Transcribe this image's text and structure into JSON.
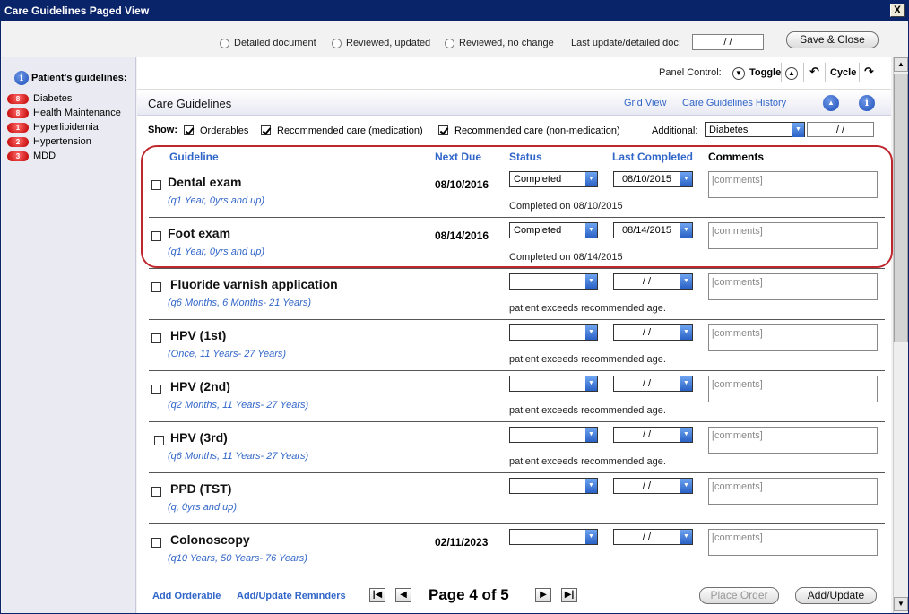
{
  "window": {
    "title": "Care Guidelines Paged View",
    "close": "X"
  },
  "top": {
    "radios": [
      "Detailed document",
      "Reviewed, updated",
      "Reviewed, no change"
    ],
    "last_update_label": "Last update/detailed doc:",
    "last_update_value": "/ /",
    "save_close": "Save & Close"
  },
  "sidebar": {
    "title": "Patient's guidelines:",
    "items": [
      {
        "count": "8",
        "label": "Diabetes"
      },
      {
        "count": "8",
        "label": "Health Maintenance"
      },
      {
        "count": "1",
        "label": "Hyperlipidemia"
      },
      {
        "count": "2",
        "label": "Hypertension"
      },
      {
        "count": "3",
        "label": "MDD"
      }
    ]
  },
  "panel": {
    "label": "Panel Control:",
    "toggle": "Toggle",
    "cycle": "Cycle"
  },
  "cg": {
    "title": "Care Guidelines",
    "grid_view": "Grid View",
    "history": "Care Guidelines History"
  },
  "show": {
    "label": "Show:",
    "orderables": "Orderables",
    "rec_med": "Recommended care (medication)",
    "rec_nonmed": "Recommended care (non-medication)",
    "additional_label": "Additional:",
    "additional_value": "Diabetes",
    "additional_date": "/ /"
  },
  "columns": {
    "guideline": "Guideline",
    "next_due": "Next Due",
    "status": "Status",
    "last_completed": "Last Completed",
    "comments": "Comments"
  },
  "rows": [
    {
      "name": "Dental exam",
      "freq": "(q1 Year, 0yrs and up)",
      "due": "08/10/2016",
      "status": "Completed",
      "last": "08/10/2015",
      "comment": "[comments]",
      "note": "Completed on 08/10/2015"
    },
    {
      "name": "Foot exam",
      "freq": "(q1 Year, 0yrs and up)",
      "due": "08/14/2016",
      "status": "Completed",
      "last": "08/14/2015",
      "comment": "[comments]",
      "note": "Completed on 08/14/2015"
    },
    {
      "name": "Fluoride varnish application",
      "freq": "(q6 Months, 6 Months- 21 Years)",
      "due": "",
      "status": "",
      "last": "/ /",
      "comment": "[comments]",
      "note": "patient exceeds recommended age."
    },
    {
      "name": "HPV (1st)",
      "freq": "(Once, 11 Years- 27 Years)",
      "due": "",
      "status": "",
      "last": "/ /",
      "comment": "[comments]",
      "note": "patient exceeds recommended age."
    },
    {
      "name": "HPV (2nd)",
      "freq": "(q2 Months, 11 Years- 27 Years)",
      "due": "",
      "status": "",
      "last": "/ /",
      "comment": "[comments]",
      "note": "patient exceeds recommended age."
    },
    {
      "name": "HPV (3rd)",
      "freq": "(q6 Months, 11 Years- 27 Years)",
      "due": "",
      "status": "",
      "last": "/ /",
      "comment": "[comments]",
      "note": "patient exceeds recommended age."
    },
    {
      "name": "PPD (TST)",
      "freq": "(q, 0yrs and up)",
      "due": "",
      "status": "",
      "last": "/ /",
      "comment": "[comments]",
      "note": ""
    },
    {
      "name": "Colonoscopy",
      "freq": "(q10 Years, 50 Years- 76 Years)",
      "due": "02/11/2023",
      "status": "",
      "last": "/ /",
      "comment": "[comments]",
      "note": ""
    }
  ],
  "footer": {
    "add_orderable": "Add Orderable",
    "add_update_reminders": "Add/Update Reminders",
    "page": "Page 4 of 5",
    "place_order": "Place Order",
    "add_update": "Add/Update"
  },
  "colors": {
    "title_bar": "#0a246a",
    "link": "#3166c9",
    "highlight": "#c0272d",
    "pill": "#c00000"
  }
}
